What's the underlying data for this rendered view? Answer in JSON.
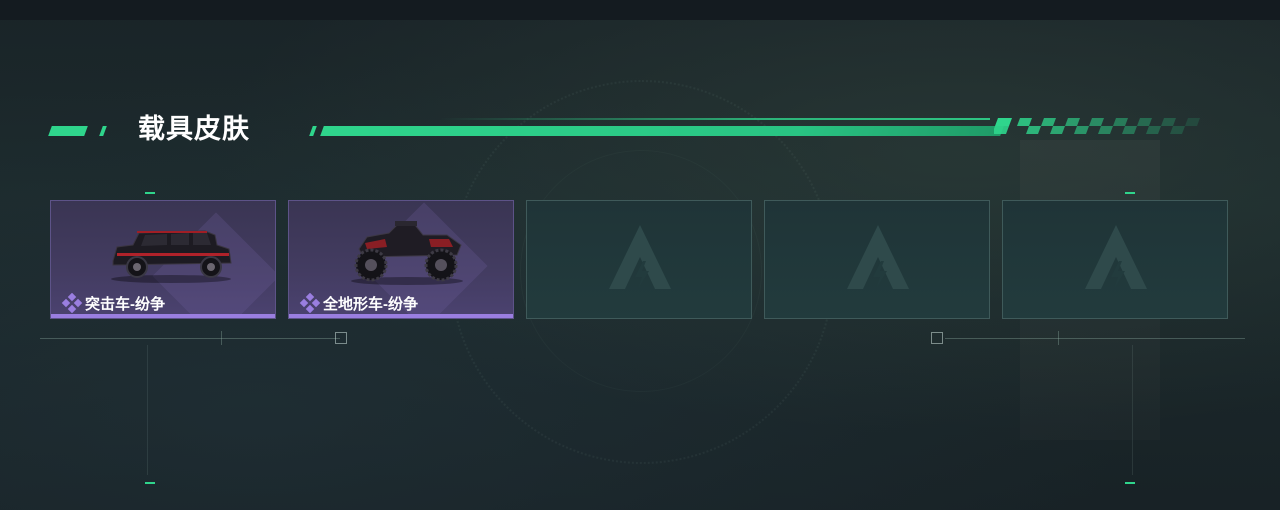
{
  "section": {
    "title": "载具皮肤"
  },
  "slots": [
    {
      "state": "filled",
      "name": "突击车-纷争",
      "vehicle_icon": "armored-suv-icon",
      "rarity_icon": "purple-diamond-icon"
    },
    {
      "state": "filled",
      "name": "全地形车-纷争",
      "vehicle_icon": "atv-quad-icon",
      "rarity_icon": "purple-diamond-icon"
    },
    {
      "state": "empty",
      "name": "",
      "vehicle_icon": "empty-slot-logo-icon"
    },
    {
      "state": "empty",
      "name": "",
      "vehicle_icon": "empty-slot-logo-icon"
    },
    {
      "state": "empty",
      "name": "",
      "vehicle_icon": "empty-slot-logo-icon"
    }
  ],
  "colors": {
    "accent_green": "#2fd58c",
    "rarity_purple": "#9a7ee0",
    "filled_card": "#433c61",
    "empty_card": "#223b3d"
  }
}
